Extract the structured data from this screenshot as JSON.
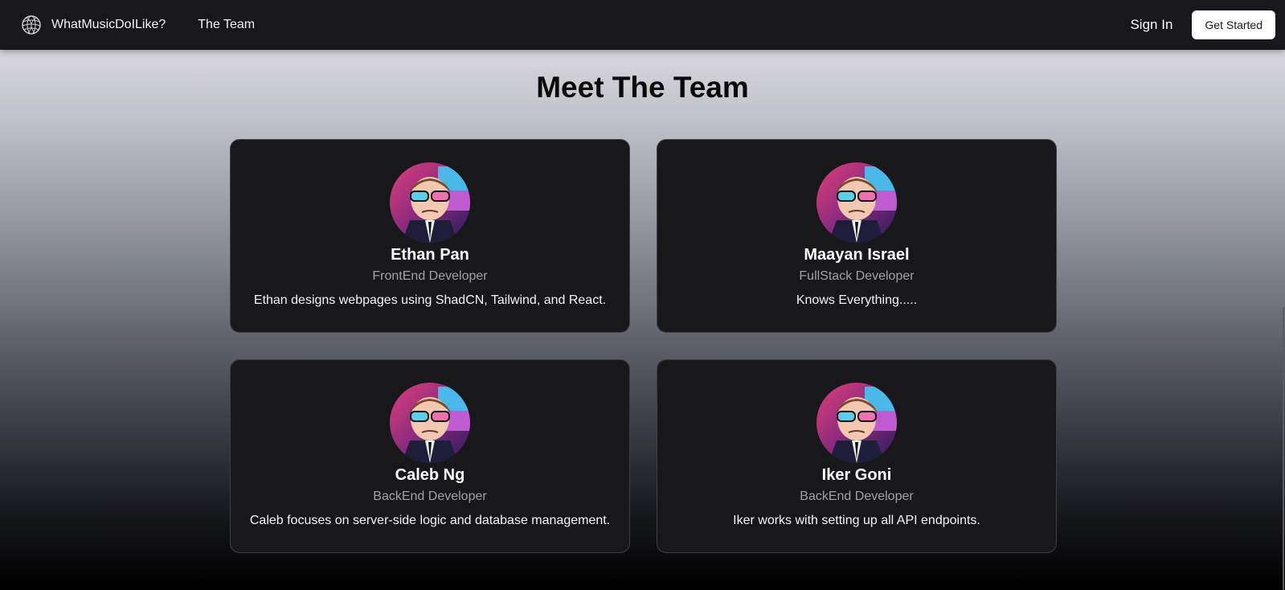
{
  "navbar": {
    "brand_name": "WhatMusicDoILike?",
    "brand_icon": "globe-icon",
    "links": [
      {
        "label": "The Team"
      }
    ],
    "signin_label": "Sign In",
    "get_started_label": "Get Started"
  },
  "page": {
    "title": "Meet The Team"
  },
  "team": [
    {
      "name": "Ethan Pan",
      "role": "FrontEnd Developer",
      "description": "Ethan designs webpages using ShadCN, Tailwind, and React.",
      "avatar": "avatar-image"
    },
    {
      "name": "Maayan Israel",
      "role": "FullStack Developer",
      "description": "Knows Everything.....",
      "avatar": "avatar-image"
    },
    {
      "name": "Caleb Ng",
      "role": "BackEnd Developer",
      "description": "Caleb focuses on server-side logic and database management.",
      "avatar": "avatar-image"
    },
    {
      "name": "Iker Goni",
      "role": "BackEnd Developer",
      "description": "Iker works with setting up all API endpoints.",
      "avatar": "avatar-image"
    }
  ],
  "colors": {
    "navbar_bg": "#18181b",
    "card_bg": "#18181b",
    "card_border": "#3f3f46",
    "role_text": "#a1a1aa",
    "button_bg": "#ffffff"
  }
}
